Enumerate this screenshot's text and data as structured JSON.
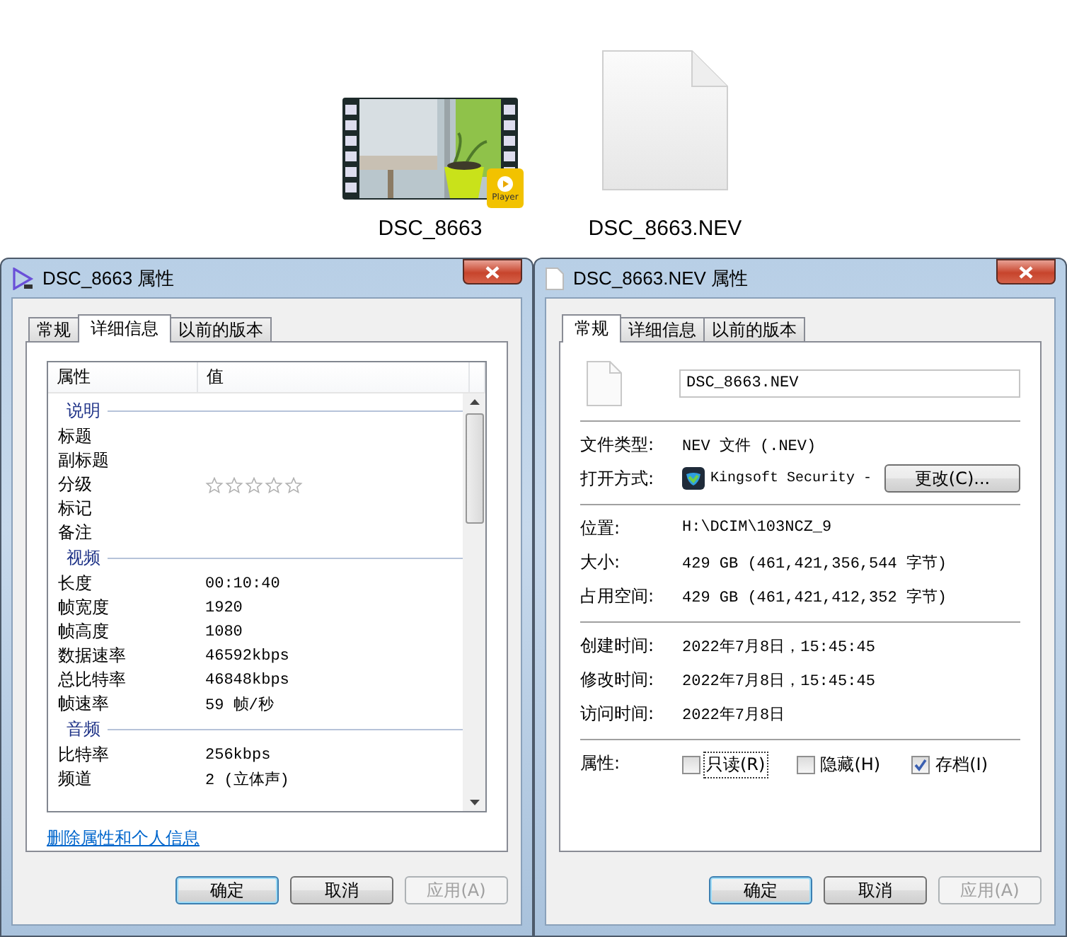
{
  "files": [
    {
      "kind": "video",
      "name": "DSC_8663",
      "badge": "Player"
    },
    {
      "kind": "blank",
      "name": "DSC_8663.NEV"
    }
  ],
  "left_window": {
    "title": "DSC_8663 属性",
    "tabs": [
      {
        "label": "常规",
        "selected": false
      },
      {
        "label": "详细信息",
        "selected": true
      },
      {
        "label": "以前的版本",
        "selected": false
      }
    ],
    "columns": [
      "属性",
      "值"
    ],
    "groups": [
      {
        "name": "说明",
        "rows": [
          {
            "property": "标题"
          },
          {
            "property": "副标题"
          },
          {
            "property": "分级",
            "stars": 0
          },
          {
            "property": "标记"
          },
          {
            "property": "备注"
          }
        ]
      },
      {
        "name": "视频",
        "rows": [
          {
            "property": "长度",
            "value": "00:10:40"
          },
          {
            "property": "帧宽度",
            "value": "1920"
          },
          {
            "property": "帧高度",
            "value": "1080"
          },
          {
            "property": "数据速率",
            "value": "46592kbps"
          },
          {
            "property": "总比特率",
            "value": "46848kbps"
          },
          {
            "property": "帧速率",
            "value": "59 帧/秒"
          }
        ]
      },
      {
        "name": "音频",
        "rows": [
          {
            "property": "比特率",
            "value": "256kbps"
          },
          {
            "property": "频道",
            "value": "2 (立体声)"
          }
        ]
      }
    ],
    "link": "删除属性和个人信息",
    "buttons": [
      {
        "label": "确定",
        "default": true,
        "disabled": false
      },
      {
        "label": "取消",
        "default": false,
        "disabled": false
      },
      {
        "label": "应用(A)",
        "default": false,
        "disabled": true
      }
    ]
  },
  "right_window": {
    "title": "DSC_8663.NEV 属性",
    "tabs": [
      {
        "label": "常规",
        "selected": true
      },
      {
        "label": "详细信息",
        "selected": false
      },
      {
        "label": "以前的版本",
        "selected": false
      }
    ],
    "file_name": "DSC_8663.NEV",
    "sections": [
      [
        {
          "kind": "text",
          "label": "文件类型:",
          "value": "NEV 文件 (.NEV)"
        },
        {
          "kind": "app",
          "label": "打开方式:",
          "value": "Kingsoft Security -",
          "button": "更改(C)..."
        }
      ],
      [
        {
          "kind": "text",
          "label": "位置:",
          "value": "H:\\DCIM\\103NCZ_9"
        },
        {
          "kind": "text",
          "label": "大小:",
          "value": "429 GB (461,421,356,544 字节)"
        },
        {
          "kind": "text",
          "label": "占用空间:",
          "value": "429 GB (461,421,412,352 字节)"
        }
      ],
      [
        {
          "kind": "text",
          "label": "创建时间:",
          "value": "2022年7月8日，15:45:45"
        },
        {
          "kind": "text",
          "label": "修改时间:",
          "value": "2022年7月8日，15:45:45"
        },
        {
          "kind": "text",
          "label": "访问时间:",
          "value": "2022年7月8日"
        }
      ],
      [
        {
          "kind": "attributes",
          "label": "属性:",
          "options": [
            {
              "label": "只读(R)",
              "checked": false,
              "focused": true
            },
            {
              "label": "隐藏(H)",
              "checked": false,
              "focused": false
            },
            {
              "label": "存档(I)",
              "checked": true,
              "focused": false
            }
          ]
        }
      ]
    ],
    "buttons": [
      {
        "label": "确定",
        "default": true,
        "disabled": false
      },
      {
        "label": "取消",
        "default": false,
        "disabled": false
      },
      {
        "label": "应用(A)",
        "default": false,
        "disabled": true
      }
    ]
  }
}
